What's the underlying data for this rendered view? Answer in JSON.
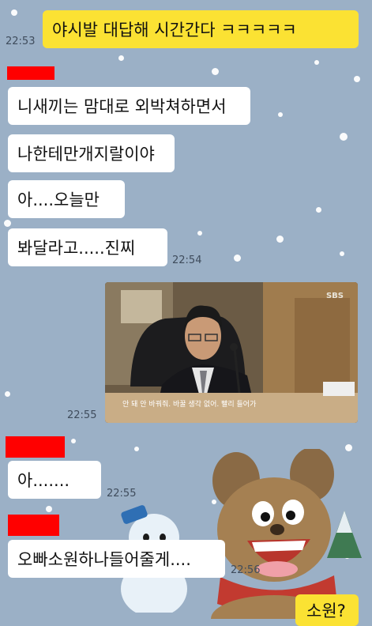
{
  "messages": [
    {
      "type": "sent",
      "text": "야시발 대답해 시간간다 ㅋㅋㅋㅋㅋ",
      "time": "22:53"
    },
    {
      "type": "received",
      "text": "니새끼는 맘대로 외박쳐하면서"
    },
    {
      "type": "received",
      "text": "나한테만개지랄이야"
    },
    {
      "type": "received",
      "text": "아....오늘만"
    },
    {
      "type": "received",
      "text": "봐달라고.....진찌",
      "time": "22:54"
    },
    {
      "type": "received_video",
      "channel": "SBS",
      "subtitle": "안 돼 안 바꿔줘. 바꿀 생각 없어. 빨리 들어가",
      "time": "22:55"
    },
    {
      "type": "received",
      "text": "아.......",
      "time": "22:55"
    },
    {
      "type": "received",
      "text": "오빠소원하나들어줄게....",
      "time": "22:56"
    },
    {
      "type": "sent",
      "text": "소원?"
    }
  ],
  "colors": {
    "background": "#9bb0c6",
    "sent_bubble": "#fbe233",
    "received_bubble": "#ffffff",
    "redaction": "#ff0000"
  }
}
